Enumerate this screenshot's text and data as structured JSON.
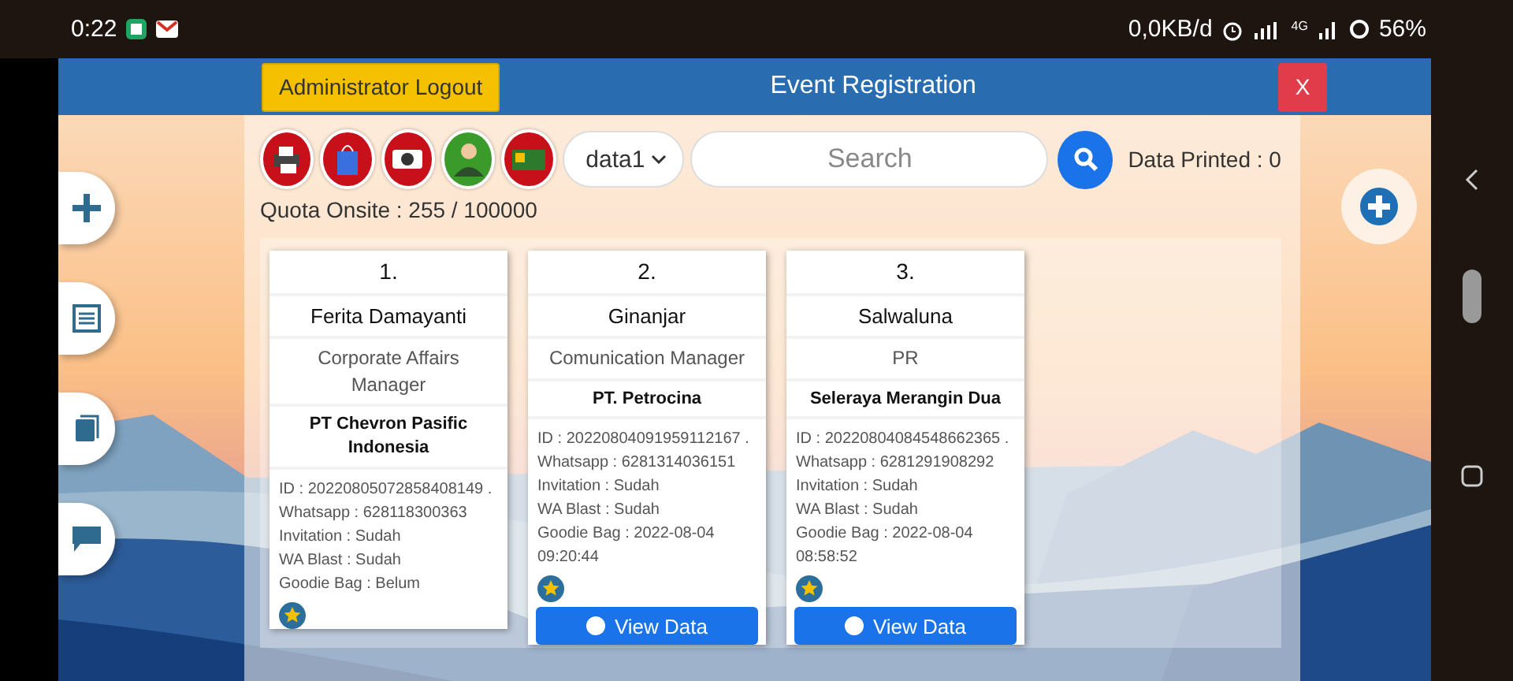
{
  "status_bar": {
    "time": "0:22",
    "network_speed": "0,0KB/d",
    "network_type": "4G",
    "battery": "56%"
  },
  "header": {
    "logout_button": "Administrator Logout",
    "title": "Event Registration",
    "close_button": "X"
  },
  "toolbar": {
    "tools": [
      {
        "kind": "printer",
        "color": "#c8101a"
      },
      {
        "kind": "bag",
        "color": "#c8101a"
      },
      {
        "kind": "camera",
        "color": "#c8101a"
      },
      {
        "kind": "person",
        "color": "#3a9a2a"
      },
      {
        "kind": "banner",
        "color": "#c8101a"
      }
    ],
    "dataset_select": "data1",
    "search": {
      "placeholder": "Search"
    },
    "data_printed": "Data Printed : 0",
    "quota": "Quota Onsite : 255 / 100000"
  },
  "side_tabs": [
    {
      "kind": "add"
    },
    {
      "kind": "list"
    },
    {
      "kind": "book"
    },
    {
      "kind": "chat"
    }
  ],
  "cards": [
    {
      "number": "1.",
      "name": "Ferita Damayanti",
      "position": "Corporate Affairs Manager",
      "company": "PT Chevron Pasific Indonesia",
      "details": [
        "ID : 20220805072858408149 .",
        "Whatsapp : 628118300363",
        "Invitation : Sudah",
        "WA Blast : Sudah",
        "Goodie Bag : Belum"
      ]
    },
    {
      "number": "2.",
      "name": "Ginanjar",
      "position": "Comunication Manager",
      "company": "PT. Petrocina",
      "details": [
        "ID : 20220804091959112167 .",
        "Whatsapp : 6281314036151",
        "Invitation : Sudah",
        "WA Blast : Sudah",
        "Goodie Bag : 2022-08-04 09:20:44"
      ],
      "view_button": "View Data"
    },
    {
      "number": "3.",
      "name": "Salwaluna",
      "position": "PR",
      "company": "Seleraya Merangin Dua",
      "details": [
        "ID : 20220804084548662365 .",
        "Whatsapp : 6281291908292",
        "Invitation : Sudah",
        "WA Blast : Sudah",
        "Goodie Bag : 2022-08-04 08:58:52"
      ],
      "view_button": "View Data"
    }
  ]
}
